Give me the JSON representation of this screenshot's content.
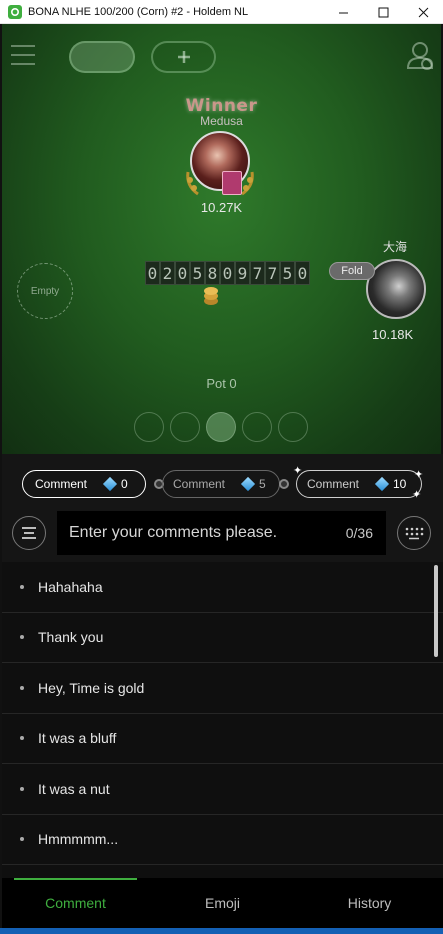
{
  "window": {
    "title": "BONA NLHE 100/200 (Corn) #2 - Holdem NL",
    "controls": [
      "minimize-icon",
      "maximize-icon",
      "close-icon"
    ]
  },
  "table": {
    "winner_label": "Winner",
    "winner_name": "Medusa",
    "winner_stack": "10.27K",
    "empty_seat_label": "Empty",
    "board_digits": [
      "0",
      "2",
      "0",
      "5",
      "8",
      "0",
      "9",
      "7",
      "7",
      "5",
      "0"
    ],
    "opponent_name": "大海",
    "opponent_status": "Fold",
    "opponent_stack": "10.18K",
    "pot": "Pot 0"
  },
  "comment_tiers": [
    {
      "label": "Comment",
      "value": "0"
    },
    {
      "label": "Comment",
      "value": "5"
    },
    {
      "label": "Comment",
      "value": "10"
    }
  ],
  "input": {
    "placeholder": "Enter your comments please.",
    "count": "0/36"
  },
  "comments": [
    "Hahahaha",
    "Thank you",
    "Hey, Time is gold",
    "It was a bluff",
    "It was a nut",
    "Hmmmmm..."
  ],
  "tabs": {
    "comment": "Comment",
    "emoji": "Emoji",
    "history": "History"
  },
  "colors": {
    "accent": "#3fae3f",
    "felt": "#215c1f",
    "panel": "#151515"
  }
}
